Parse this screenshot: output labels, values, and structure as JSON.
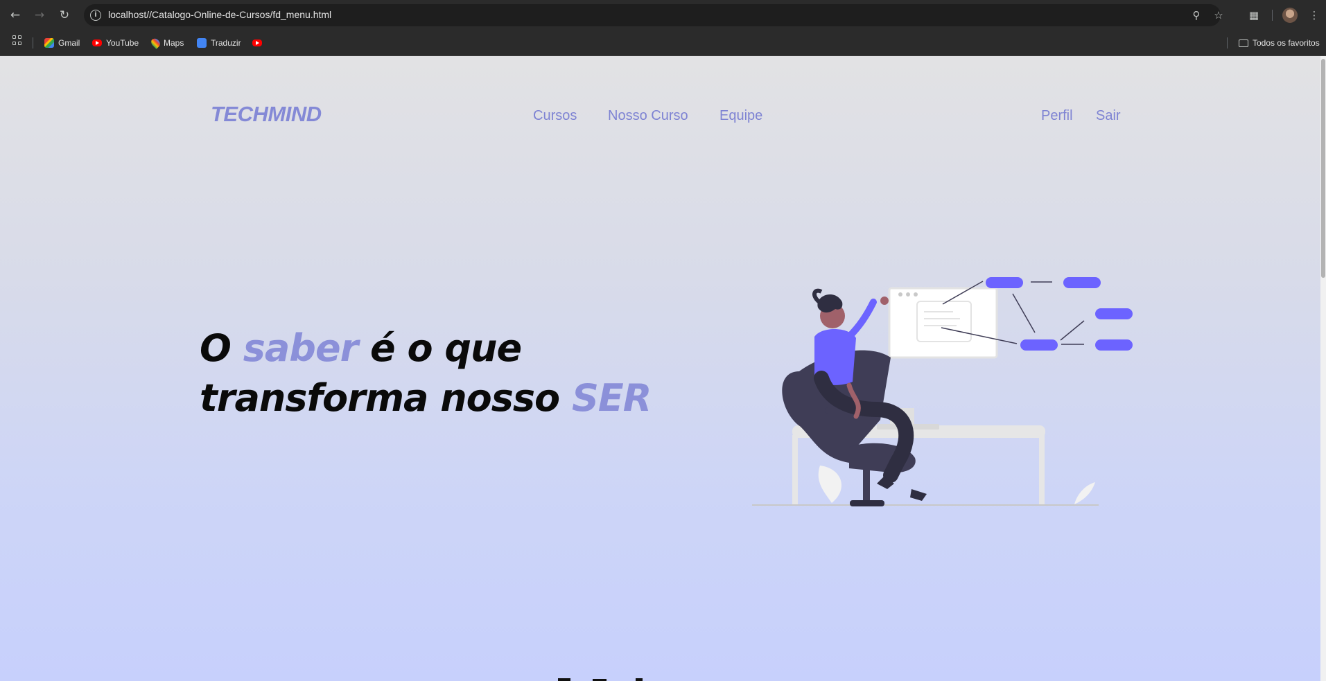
{
  "browser": {
    "url": "localhost//Catalogo-Online-de-Cursos/fd_menu.html",
    "bookmarks": [
      {
        "label": "Gmail",
        "icon": "gmail-icon"
      },
      {
        "label": "YouTube",
        "icon": "youtube-icon"
      },
      {
        "label": "Maps",
        "icon": "maps-icon"
      },
      {
        "label": "Traduzir",
        "icon": "translate-icon"
      },
      {
        "label": "",
        "icon": "youtube-icon"
      }
    ],
    "all_bookmarks_label": "Todos os favoritos"
  },
  "site": {
    "logo": "TECHMIND",
    "nav": {
      "cursos": "Cursos",
      "nosso_curso": "Nosso Curso",
      "equipe": "Equipe",
      "perfil": "Perfil",
      "sair": "Sair"
    },
    "hero": {
      "w1": "O",
      "w2": "saber",
      "w3": "é o que",
      "w4": "transforma nosso",
      "w5": "SER"
    },
    "colors": {
      "accent": "#8489d6",
      "illustration_accent": "#6c63ff",
      "text": "#0a0a0a"
    }
  }
}
